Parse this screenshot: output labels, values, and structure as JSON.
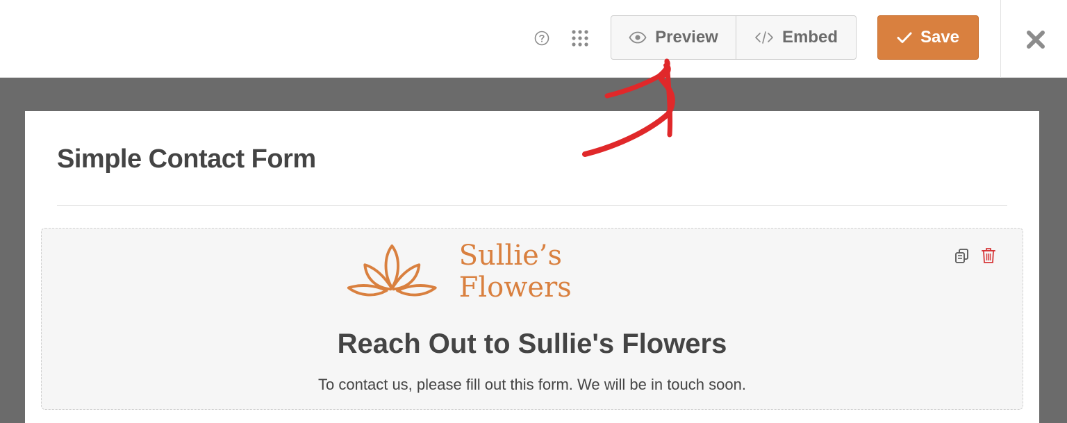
{
  "toolbar": {
    "preview_label": "Preview",
    "embed_label": "Embed",
    "save_label": "Save",
    "help_icon": "help-circle-icon",
    "apps_icon": "grid-dots-icon",
    "close_icon": "close-x-icon"
  },
  "form": {
    "title": "Simple Contact Form",
    "field": {
      "logo_text": "Sullie’s Flowers",
      "heading": "Reach Out to Sullie's Flowers",
      "description": "To contact us, please fill out this form. We will be in touch soon."
    }
  },
  "colors": {
    "accent": "#d9803f",
    "builder_bg": "#6b6b6b",
    "annotation_red": "#e0282a",
    "delete_red": "#d63638"
  }
}
